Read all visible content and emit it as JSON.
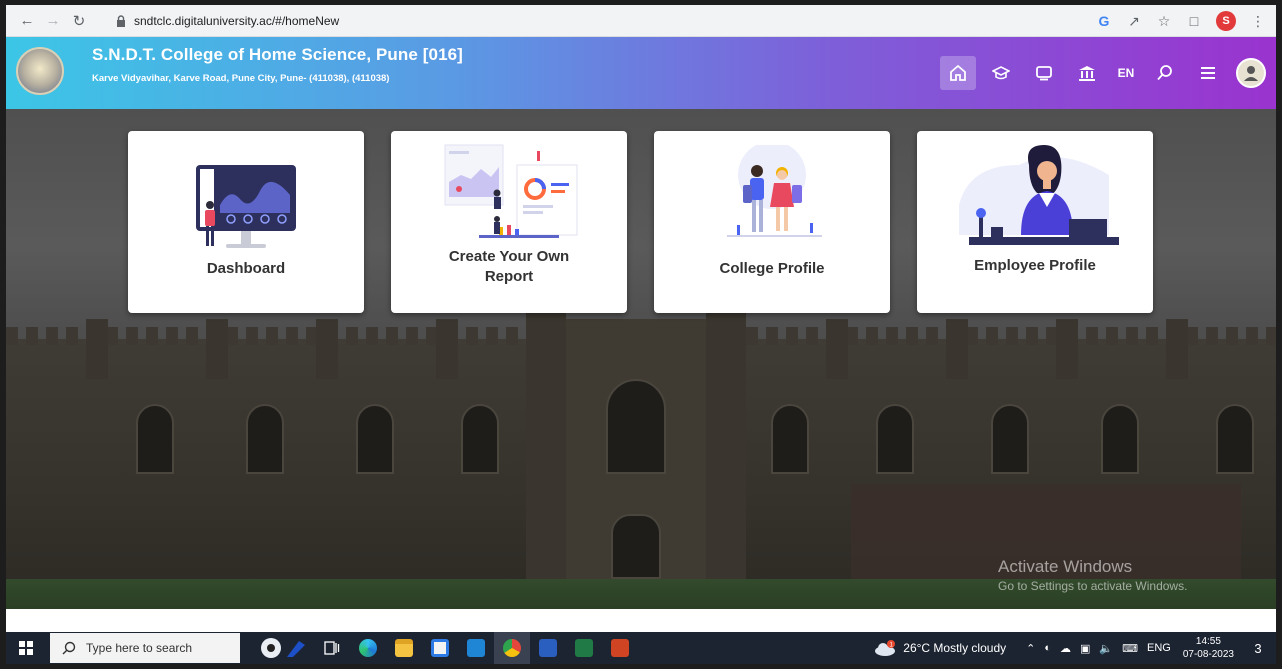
{
  "browser": {
    "url": "sndtclc.digitaluniversity.ac/#/homeNew",
    "profile_initial": "S",
    "back_icon": "arrow-left-icon",
    "forward_icon": "arrow-right-icon",
    "reload_icon": "reload-icon"
  },
  "header": {
    "college_name": "S.N.D.T. College of Home Science, Pune [016]",
    "college_address": "Karve Vidyavihar, Karve Road, Pune City, Pune- (411038), (411038)",
    "language": "EN",
    "icons": [
      "home-icon",
      "graduation-cap-icon",
      "display-icon",
      "bank-icon",
      "search-icon",
      "menu-icon"
    ]
  },
  "cards": [
    {
      "label": "Dashboard",
      "icon": "dashboard-illustration"
    },
    {
      "label": "Create Your Own Report",
      "line1": "Create Your Own",
      "line2": "Report",
      "icon": "report-illustration"
    },
    {
      "label": "College Profile",
      "icon": "students-illustration"
    },
    {
      "label": "Employee Profile",
      "icon": "employee-illustration"
    }
  ],
  "watermark": {
    "title": "Activate Windows",
    "subtitle": "Go to Settings to activate Windows."
  },
  "taskbar": {
    "search_placeholder": "Type here to search",
    "weather": "26°C  Mostly cloudy",
    "weather_badge": "1",
    "language": "ENG",
    "time": "14:55",
    "date": "07-08-2023",
    "notification_count": "3"
  }
}
